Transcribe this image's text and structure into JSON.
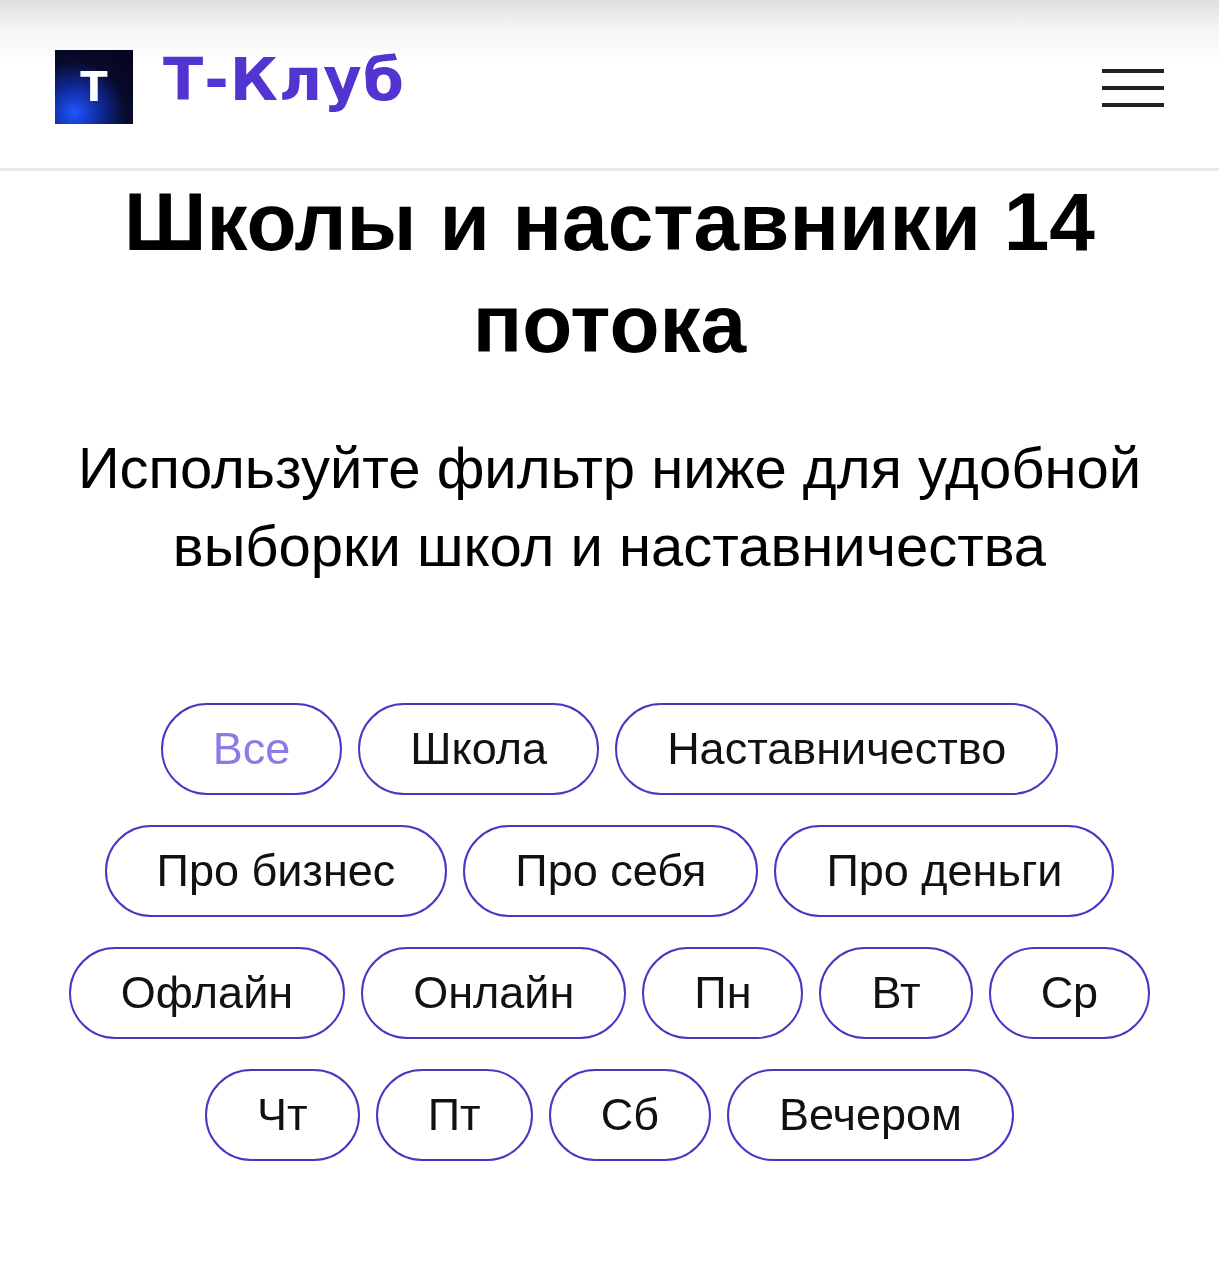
{
  "header": {
    "logo": {
      "letter": "Т"
    },
    "brand": "Т-Клуб"
  },
  "title": "Школы и наставники 14 потока",
  "subtitle": "Используйте фильтр ниже для удобной выборки школ и наставничества",
  "filters": [
    {
      "label": "Все",
      "selected": true
    },
    {
      "label": "Школа",
      "selected": false
    },
    {
      "label": "Наставничество",
      "selected": false
    },
    {
      "label": "Про бизнес",
      "selected": false
    },
    {
      "label": "Про себя",
      "selected": false
    },
    {
      "label": "Про деньги",
      "selected": false
    },
    {
      "label": "Офлайн",
      "selected": false
    },
    {
      "label": "Онлайн",
      "selected": false
    },
    {
      "label": "Пн",
      "selected": false
    },
    {
      "label": "Вт",
      "selected": false
    },
    {
      "label": "Ср",
      "selected": false
    },
    {
      "label": "Чт",
      "selected": false
    },
    {
      "label": "Пт",
      "selected": false
    },
    {
      "label": "Сб",
      "selected": false
    },
    {
      "label": "Вечером",
      "selected": false
    }
  ]
}
